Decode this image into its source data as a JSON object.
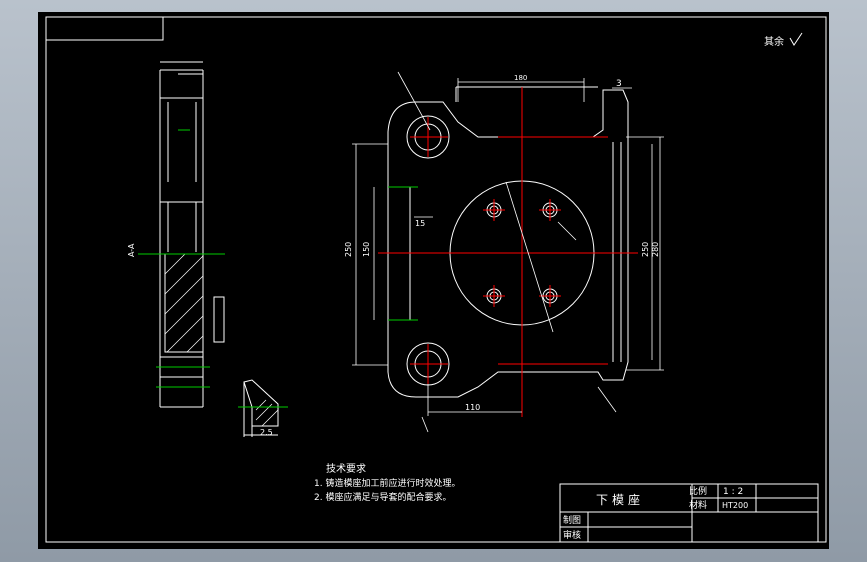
{
  "surface_finish_note": "其余",
  "tech_requirements": {
    "title": "技术要求",
    "items": [
      "1. 铸造模座加工前应进行时效处理。",
      "2. 模座应满足与导套的配合要求。"
    ]
  },
  "title_block": {
    "part_name": "下模座",
    "scale_label": "比例",
    "scale_value": "1 : 2",
    "material_label": "材料",
    "material_value": "HT200",
    "drawn_label": "制图",
    "checked_label": "审核"
  },
  "dimensions": {
    "top_width": "180",
    "top_offset": "3",
    "left_height": "250",
    "inner_height": "150",
    "right_height": "250",
    "right_height2": "280",
    "slot_width": "15",
    "bottom_width": "110",
    "thickness": "2.5",
    "section_label": "A-A"
  },
  "colors": {
    "background": "#000000",
    "lines": "#ffffff",
    "centerline": "#ff0000",
    "hatch_axis": "#00cc00"
  }
}
